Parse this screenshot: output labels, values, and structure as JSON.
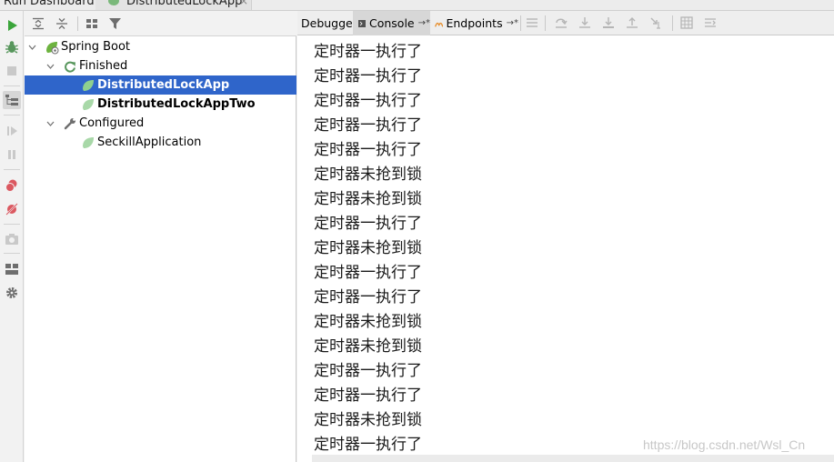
{
  "window": {
    "title": "Run Dashboard:",
    "active_tab": "DistributedLockApp",
    "close_glyph": "×"
  },
  "left_toolbar": {
    "icons": [
      "run-icon",
      "debug-icon",
      "stop-icon",
      "tree-view-icon",
      "resume-icon",
      "pause-icon",
      "breakpoints-icon",
      "mute-breakpoints-icon",
      "camera-icon",
      "layout-icon",
      "settings-icon"
    ]
  },
  "tree_toolbar": {
    "icons": [
      "expand-all-icon",
      "collapse-all-icon",
      "group-icon",
      "filter-icon"
    ]
  },
  "tree": {
    "root": {
      "label": "Spring Boot",
      "icon": "spring-boot-icon",
      "expanded": true
    },
    "groups": [
      {
        "label": "Finished",
        "icon": "refresh-icon",
        "expanded": true,
        "items": [
          {
            "label": "DistributedLockApp",
            "icon": "spring-leaf-icon",
            "selected": true,
            "bold": true
          },
          {
            "label": "DistributedLockAppTwo",
            "icon": "spring-leaf-icon",
            "selected": false,
            "bold": true
          }
        ]
      },
      {
        "label": "Configured",
        "icon": "wrench-icon",
        "expanded": true,
        "items": [
          {
            "label": "SeckillApplication",
            "icon": "spring-leaf-icon",
            "selected": false,
            "bold": false
          }
        ]
      }
    ]
  },
  "tabs": [
    {
      "label": "Debugger",
      "active": false,
      "pin": ""
    },
    {
      "label": "Console",
      "active": true,
      "pin": "→*"
    },
    {
      "label": "Endpoints",
      "active": false,
      "pin": "→*"
    }
  ],
  "console_toolbar_icons": [
    "menu-icon",
    "step-over-icon",
    "step-into-icon",
    "force-step-into-icon",
    "step-out-icon",
    "run-to-cursor-icon",
    "evaluate-icon",
    "trace-icon"
  ],
  "console": {
    "lines": [
      "定时器一执行了",
      "定时器一执行了",
      "定时器一执行了",
      "定时器一执行了",
      "定时器一执行了",
      "定时器未抢到锁",
      "定时器未抢到锁",
      "定时器一执行了",
      "定时器未抢到锁",
      "定时器一执行了",
      "定时器一执行了",
      "定时器未抢到锁",
      "定时器未抢到锁",
      "定时器一执行了",
      "定时器一执行了",
      "定时器未抢到锁",
      "定时器一执行了"
    ]
  },
  "watermark": "https://blog.csdn.net/Wsl_Cn",
  "colors": {
    "selection": "#2f65ca",
    "run_green": "#3ba53b",
    "debug_green": "#57965c",
    "spring_green": "#6db33f",
    "breakpoint_red": "#db5860"
  }
}
